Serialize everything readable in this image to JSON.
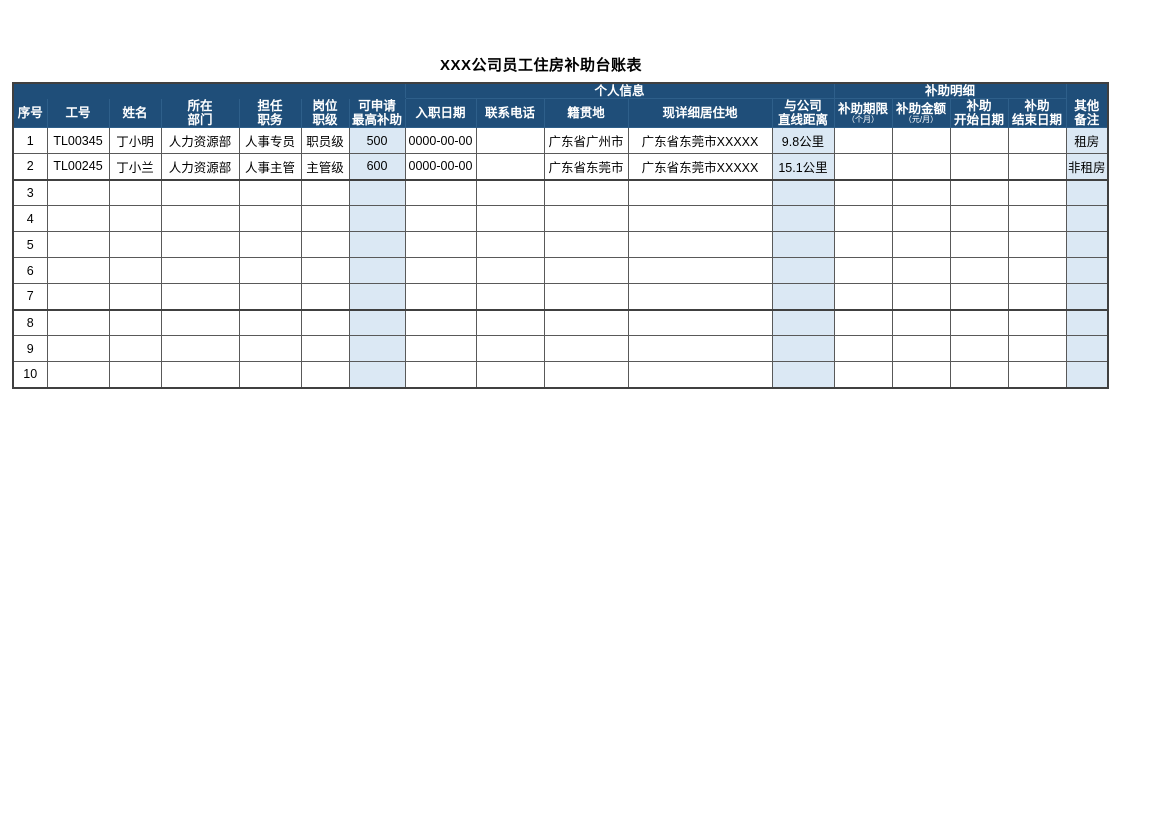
{
  "document": {
    "title": "XXX公司员工住房补助台账表"
  },
  "theme": {
    "header_bg": "#1f4e79",
    "header_text": "#ffffff",
    "highlight_bg": "#dbe8f4",
    "grid_line": "#595959",
    "frame_line": "#404040",
    "page_bg": "#ffffff"
  },
  "table": {
    "group_headers": [
      {
        "label": "",
        "span": 7
      },
      {
        "label": "个人信息",
        "span": 5
      },
      {
        "label": "补助明细",
        "span": 4
      },
      {
        "label": "",
        "span": 1
      }
    ],
    "columns": [
      {
        "key": "seq",
        "line1": "序号",
        "line2": "",
        "sub": "",
        "width": 34,
        "highlight": false
      },
      {
        "key": "emp_id",
        "line1": "工号",
        "line2": "",
        "sub": "",
        "width": 62,
        "highlight": false
      },
      {
        "key": "name",
        "line1": "姓名",
        "line2": "",
        "sub": "",
        "width": 52,
        "highlight": false
      },
      {
        "key": "dept",
        "line1": "所在",
        "line2": "部门",
        "sub": "",
        "width": 78,
        "highlight": false
      },
      {
        "key": "position",
        "line1": "担任",
        "line2": "职务",
        "sub": "",
        "width": 62,
        "highlight": false
      },
      {
        "key": "rank",
        "line1": "岗位",
        "line2": "职级",
        "sub": "",
        "width": 48,
        "highlight": false
      },
      {
        "key": "max_sub",
        "line1": "可申请",
        "line2": "最高补助",
        "sub": "",
        "width": 56,
        "highlight": true
      },
      {
        "key": "hire_date",
        "line1": "入职日期",
        "line2": "",
        "sub": "",
        "width": 71,
        "highlight": false
      },
      {
        "key": "phone",
        "line1": "联系电话",
        "line2": "",
        "sub": "",
        "width": 68,
        "highlight": false
      },
      {
        "key": "hometown",
        "line1": "籍贯地",
        "line2": "",
        "sub": "",
        "width": 84,
        "highlight": false
      },
      {
        "key": "address",
        "line1": "现详细居住地",
        "line2": "",
        "sub": "",
        "width": 144,
        "highlight": false
      },
      {
        "key": "distance",
        "line1": "与公司",
        "line2": "直线距离",
        "sub": "",
        "width": 62,
        "highlight": true
      },
      {
        "key": "sub_months",
        "line1": "补助期限",
        "line2": "",
        "sub": "（个月）",
        "width": 58,
        "highlight": false
      },
      {
        "key": "sub_amount",
        "line1": "补助金额",
        "line2": "",
        "sub": "（元/月）",
        "width": 58,
        "highlight": false
      },
      {
        "key": "sub_start",
        "line1": "补助",
        "line2": "开始日期",
        "sub": "",
        "width": 58,
        "highlight": false
      },
      {
        "key": "sub_end",
        "line1": "补助",
        "line2": "结束日期",
        "sub": "",
        "width": 58,
        "highlight": false
      },
      {
        "key": "remark",
        "line1": "其他",
        "line2": "备注",
        "sub": "",
        "width": 42,
        "highlight": true
      }
    ],
    "rows": [
      {
        "seq": "1",
        "emp_id": "TL00345",
        "name": "丁小明",
        "dept": "人力资源部",
        "position": "人事专员",
        "rank": "职员级",
        "max_sub": "500",
        "hire_date": "0000-00-00",
        "phone": "",
        "hometown": "广东省广州市",
        "address": "广东省东莞市XXXXX",
        "distance": "9.8公里",
        "sub_months": "",
        "sub_amount": "",
        "sub_start": "",
        "sub_end": "",
        "remark": "租房"
      },
      {
        "seq": "2",
        "emp_id": "TL00245",
        "name": "丁小兰",
        "dept": "人力资源部",
        "position": "人事主管",
        "rank": "主管级",
        "max_sub": "600",
        "hire_date": "0000-00-00",
        "phone": "",
        "hometown": "广东省东莞市",
        "address": "广东省东莞市XXXXX",
        "distance": "15.1公里",
        "sub_months": "",
        "sub_amount": "",
        "sub_start": "",
        "sub_end": "",
        "remark": "非租房"
      },
      {
        "seq": "3",
        "emp_id": "",
        "name": "",
        "dept": "",
        "position": "",
        "rank": "",
        "max_sub": "",
        "hire_date": "",
        "phone": "",
        "hometown": "",
        "address": "",
        "distance": "",
        "sub_months": "",
        "sub_amount": "",
        "sub_start": "",
        "sub_end": "",
        "remark": ""
      },
      {
        "seq": "4",
        "emp_id": "",
        "name": "",
        "dept": "",
        "position": "",
        "rank": "",
        "max_sub": "",
        "hire_date": "",
        "phone": "",
        "hometown": "",
        "address": "",
        "distance": "",
        "sub_months": "",
        "sub_amount": "",
        "sub_start": "",
        "sub_end": "",
        "remark": ""
      },
      {
        "seq": "5",
        "emp_id": "",
        "name": "",
        "dept": "",
        "position": "",
        "rank": "",
        "max_sub": "",
        "hire_date": "",
        "phone": "",
        "hometown": "",
        "address": "",
        "distance": "",
        "sub_months": "",
        "sub_amount": "",
        "sub_start": "",
        "sub_end": "",
        "remark": ""
      },
      {
        "seq": "6",
        "emp_id": "",
        "name": "",
        "dept": "",
        "position": "",
        "rank": "",
        "max_sub": "",
        "hire_date": "",
        "phone": "",
        "hometown": "",
        "address": "",
        "distance": "",
        "sub_months": "",
        "sub_amount": "",
        "sub_start": "",
        "sub_end": "",
        "remark": ""
      },
      {
        "seq": "7",
        "emp_id": "",
        "name": "",
        "dept": "",
        "position": "",
        "rank": "",
        "max_sub": "",
        "hire_date": "",
        "phone": "",
        "hometown": "",
        "address": "",
        "distance": "",
        "sub_months": "",
        "sub_amount": "",
        "sub_start": "",
        "sub_end": "",
        "remark": ""
      },
      {
        "seq": "8",
        "emp_id": "",
        "name": "",
        "dept": "",
        "position": "",
        "rank": "",
        "max_sub": "",
        "hire_date": "",
        "phone": "",
        "hometown": "",
        "address": "",
        "distance": "",
        "sub_months": "",
        "sub_amount": "",
        "sub_start": "",
        "sub_end": "",
        "remark": ""
      },
      {
        "seq": "9",
        "emp_id": "",
        "name": "",
        "dept": "",
        "position": "",
        "rank": "",
        "max_sub": "",
        "hire_date": "",
        "phone": "",
        "hometown": "",
        "address": "",
        "distance": "",
        "sub_months": "",
        "sub_amount": "",
        "sub_start": "",
        "sub_end": "",
        "remark": ""
      },
      {
        "seq": "10",
        "emp_id": "",
        "name": "",
        "dept": "",
        "position": "",
        "rank": "",
        "max_sub": "",
        "hire_date": "",
        "phone": "",
        "hometown": "",
        "address": "",
        "distance": "",
        "sub_months": "",
        "sub_amount": "",
        "sub_start": "",
        "sub_end": "",
        "remark": ""
      }
    ],
    "thick_separator_after_rows": [
      2,
      7
    ]
  }
}
